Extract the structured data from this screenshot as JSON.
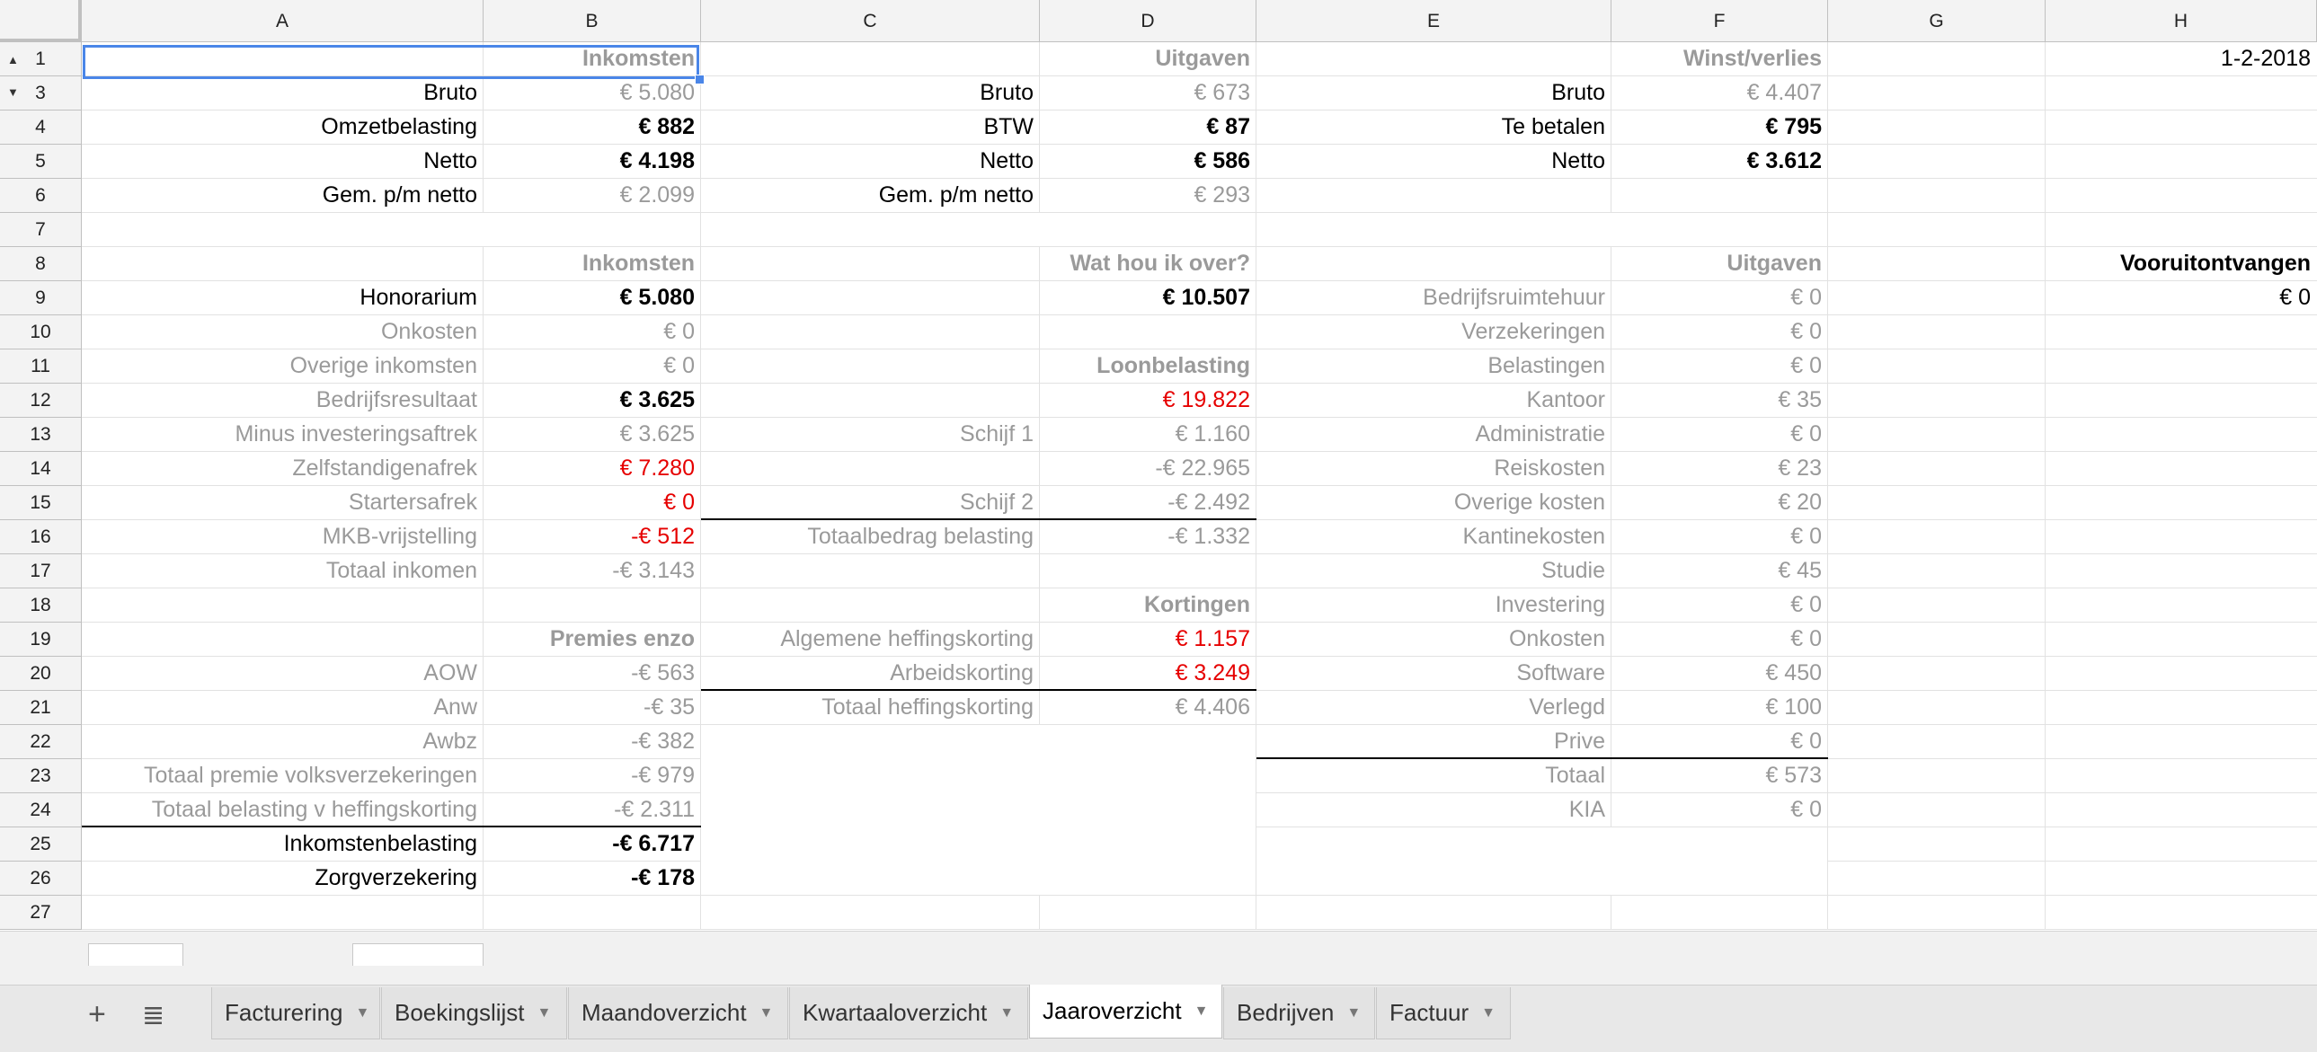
{
  "columns": [
    "A",
    "B",
    "C",
    "D",
    "E",
    "F",
    "G",
    "H"
  ],
  "rows": [
    "1",
    "3",
    "4",
    "5",
    "6",
    "7",
    "8",
    "9",
    "10",
    "11",
    "12",
    "13",
    "14",
    "15",
    "16",
    "17",
    "18",
    "19",
    "20",
    "21",
    "22",
    "23",
    "24",
    "25",
    "26",
    "27"
  ],
  "cells": {
    "B1": "Inkomsten",
    "D1": "Uitgaven",
    "F1": "Winst/verlies",
    "H1": "1-2-2018",
    "A3": "Bruto",
    "B3": "€ 5.080",
    "C3": "Bruto",
    "D3": "€ 673",
    "E3": "Bruto",
    "F3": "€ 4.407",
    "A4": "Omzetbelasting",
    "B4": "€ 882",
    "C4": "BTW",
    "D4": "€ 87",
    "E4": "Te betalen",
    "F4": "€ 795",
    "A5": "Netto",
    "B5": "€ 4.198",
    "C5": "Netto",
    "D5": "€ 586",
    "E5": "Netto",
    "F5": "€ 3.612",
    "A6": "Gem. p/m netto",
    "B6": "€ 2.099",
    "C6": "Gem. p/m netto",
    "D6": "€ 293",
    "B8": "Inkomsten",
    "D8": "Wat hou ik over?",
    "F8": "Uitgaven",
    "H8": "Vooruitontvangen",
    "A9": "Honorarium",
    "B9": "€ 5.080",
    "D9": "€ 10.507",
    "E9": "Bedrijfsruimtehuur",
    "F9": "€ 0",
    "H9": "€ 0",
    "A10": "Onkosten",
    "B10": "€ 0",
    "E10": "Verzekeringen",
    "F10": "€ 0",
    "A11": "Overige inkomsten",
    "B11": "€ 0",
    "D11": "Loonbelasting",
    "E11": "Belastingen",
    "F11": "€ 0",
    "A12": "Bedrijfsresultaat",
    "B12": "€ 3.625",
    "D12": "€ 19.822",
    "E12": "Kantoor",
    "F12": "€ 35",
    "A13": "Minus investeringsaftrek",
    "B13": "€ 3.625",
    "C13": "Schijf 1",
    "D13": "€ 1.160",
    "E13": "Administratie",
    "F13": "€ 0",
    "A14": "Zelfstandigenafrek",
    "B14": "€ 7.280",
    "D14": "-€ 22.965",
    "E14": "Reiskosten",
    "F14": "€ 23",
    "A15": "Startersafrek",
    "B15": "€ 0",
    "C15": "Schijf 2",
    "D15": "-€ 2.492",
    "E15": "Overige kosten",
    "F15": "€ 20",
    "A16": "MKB-vrijstelling",
    "B16": "-€ 512",
    "C16": "Totaalbedrag belasting",
    "D16": "-€ 1.332",
    "E16": "Kantinekosten",
    "F16": "€ 0",
    "A17": "Totaal inkomen",
    "B17": "-€ 3.143",
    "E17": "Studie",
    "F17": "€ 45",
    "D18": "Kortingen",
    "E18": "Investering",
    "F18": "€ 0",
    "B19": "Premies enzo",
    "C19": "Algemene heffingskorting",
    "D19": "€ 1.157",
    "E19": "Onkosten",
    "F19": "€ 0",
    "A20": "AOW",
    "B20": "-€ 563",
    "C20": "Arbeidskorting",
    "D20": "€ 3.249",
    "E20": "Software",
    "F20": "€ 450",
    "A21": "Anw",
    "B21": "-€ 35",
    "C21": "Totaal heffingskorting",
    "D21": "€ 4.406",
    "E21": "Verlegd",
    "F21": "€ 100",
    "A22": "Awbz",
    "B22": "-€ 382",
    "E22": "Prive",
    "F22": "€ 0",
    "A23": "Totaal premie volksverzekeringen",
    "B23": "-€ 979",
    "E23": "Totaal",
    "F23": "€ 573",
    "A24": "Totaal belasting v heffingskorting",
    "B24": "-€ 2.311",
    "E24": "KIA",
    "F24": "€ 0",
    "A25": "Inkomstenbelasting",
    "B25": "-€ 6.717",
    "A26": "Zorgverzekering",
    "B26": "-€ 178"
  },
  "sheet_tabs": [
    "Facturering",
    "Boekingslijst",
    "Maandoverzicht",
    "Kwartaaloverzicht",
    "Jaaroverzicht",
    "Bedrijven",
    "Factuur"
  ],
  "active_tab": "Jaaroverzicht",
  "icons": {
    "add_sheet": "plus-icon",
    "all_sheets": "list-icon",
    "tab_menu": "caret-down-icon"
  },
  "colors": {
    "selection": "#4a86e8",
    "negative": "#e60000",
    "muted": "#9a9a9a",
    "header_bg": "#f3f3f3"
  }
}
